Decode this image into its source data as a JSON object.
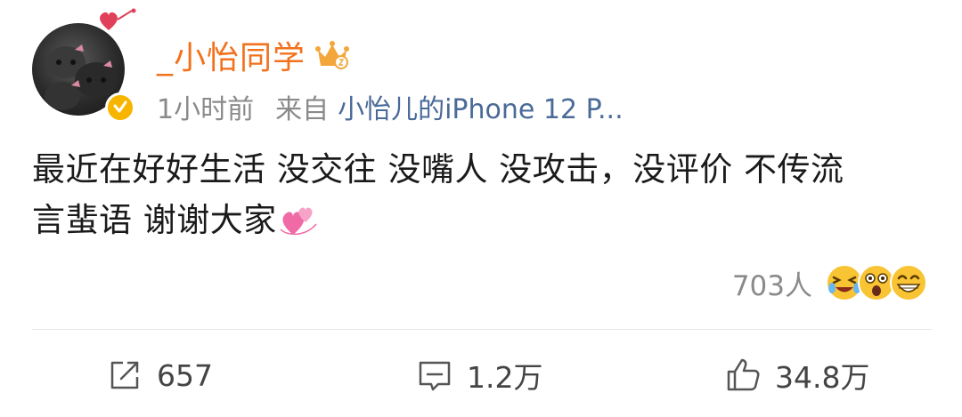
{
  "post": {
    "username": "_小怡同学",
    "time": "1小时前",
    "source_prefix": "来自",
    "device": "小怡儿的iPhone 12 P...",
    "text_line1": "最近在好好生活 没交往 没嘴人 没攻击，没评价 不传流",
    "text_line2": "言蜚语 谢谢大家"
  },
  "reactions": {
    "count": "703人",
    "emojis": [
      "laughing-tears-emoji",
      "surprised-emoji",
      "grinning-emoji"
    ]
  },
  "actions": {
    "repost_count": "657",
    "comment_count": "1.2万",
    "like_count": "34.8万"
  },
  "colors": {
    "username": "#f2711c",
    "device_link": "#4a6a98",
    "meta": "#8a8a8a",
    "verified": "#f7b500"
  }
}
